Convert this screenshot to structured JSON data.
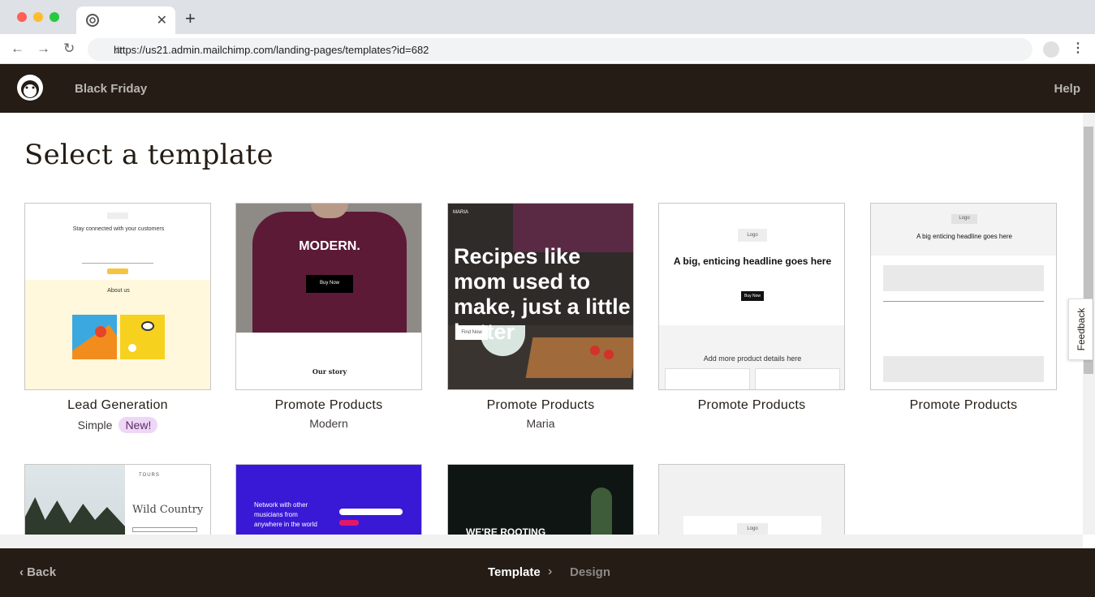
{
  "browser": {
    "url": "https://us21.admin.mailchimp.com/landing-pages/templates?id=682",
    "new_tab": "+",
    "close_tab": "✕"
  },
  "header": {
    "title": "Black Friday",
    "help": "Help"
  },
  "page": {
    "title": "Select a template"
  },
  "templates": [
    {
      "name": "Lead Generation",
      "variant": "Simple",
      "badge": "New!"
    },
    {
      "name": "Promote Products",
      "variant": "Modern"
    },
    {
      "name": "Promote Products",
      "variant": "Maria"
    },
    {
      "name": "Promote Products",
      "variant": ""
    },
    {
      "name": "Promote Products",
      "variant": ""
    }
  ],
  "thumb_text": {
    "t1_head": "Stay connected with your customers",
    "t1_about": "About us",
    "t2_brand": "MODERN.",
    "t2_button": "Buy Now",
    "t2_story": "Our story",
    "t3_brand": "MARIA",
    "t3_headline": "Recipes like mom used to make, just a little better",
    "t3_button": "Find Now",
    "t4_logo": "Logo",
    "t4_headline": "A big, enticing headline goes here",
    "t4_button": "Buy Now",
    "t4_details": "Add more product details here",
    "t5_logo": "Logo",
    "t5_headline": "A big enticing headline goes here",
    "r2_t1_brand": "TOURS",
    "r2_t1_headline": "Wild Country",
    "r2_t2_text": "Network with other musicians from anywhere in the world",
    "r2_t3_text": "WE'RE ROOTING",
    "r2_t4_logo": "Logo"
  },
  "feedback": "Feedback",
  "footer": {
    "back": "Back",
    "step_template": "Template",
    "step_design": "Design"
  },
  "colors": {
    "brand_dark": "#241c15",
    "badge_bg": "#eed7f6",
    "maroon_shirt": "#5c1a36",
    "purple_bg": "#3a19d6"
  }
}
